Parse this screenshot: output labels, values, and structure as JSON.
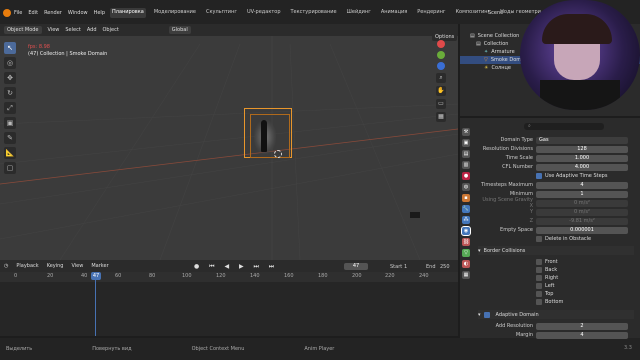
{
  "menu": {
    "items": [
      "File",
      "Edit",
      "Render",
      "Window",
      "Help"
    ]
  },
  "workspaces": {
    "tabs": [
      "Планировка",
      "Моделирование",
      "Скульптинг",
      "UV-редактор",
      "Текстурирование",
      "Шейдинг",
      "Анимация",
      "Рендеринг",
      "Композитинг",
      "Ноды геометри"
    ],
    "active": "Планировка"
  },
  "scene": {
    "label": "Scene"
  },
  "viewport": {
    "mode": "Object Mode",
    "view": "View",
    "select": "Select",
    "add": "Add",
    "object": "Object",
    "transform": "Global",
    "options": "Options",
    "fps": "fps: 8.98",
    "collection": "(47) Collection | Smoke Domain"
  },
  "timeline": {
    "playback": "Playback",
    "keying": "Keying",
    "view": "View",
    "marker": "Marker",
    "current_frame": "47",
    "start_label": "Start",
    "start": "1",
    "end_label": "End",
    "end": "250",
    "ticks": [
      "0",
      "20",
      "40",
      "60",
      "80",
      "100",
      "120",
      "140",
      "160",
      "180",
      "200",
      "220",
      "240"
    ]
  },
  "status": {
    "select": "Выделить",
    "rotate": "Повернуть вид",
    "context": "Object Context Menu",
    "anim": "Anim Player",
    "version": "3.3"
  },
  "outliner": {
    "root": "Scene Collection",
    "items": [
      {
        "label": "Collection",
        "indent": 1
      },
      {
        "label": "Armature",
        "indent": 2
      },
      {
        "label": "Smoke Dom",
        "indent": 2,
        "selected": true
      },
      {
        "label": "Солнце",
        "indent": 2
      }
    ]
  },
  "properties": {
    "rows": [
      {
        "label": "Domain Type",
        "value": "Gas",
        "dim": false
      },
      {
        "label": "Resolution Divisions",
        "value": "128",
        "dim": false
      },
      {
        "label": "Time Scale",
        "value": "1.000",
        "dim": false
      },
      {
        "label": "CFL Number",
        "value": "4.000",
        "dim": false
      },
      {
        "label": "Timesteps Maximum",
        "value": "4",
        "dim": false
      },
      {
        "label": "Minimum",
        "value": "1",
        "dim": false
      },
      {
        "label": "Using Scene Gravity X",
        "value": "0 m/s²",
        "dim": true
      },
      {
        "label": "Y",
        "value": "0 m/s²",
        "dim": true
      },
      {
        "label": "Z",
        "value": "-9.81 m/s²",
        "dim": true
      },
      {
        "label": "Empty Space",
        "value": "0.000001",
        "dim": false
      }
    ],
    "adaptive_time": "Use Adaptive Time Steps",
    "delete_obstacle": "Delete in Obstacle",
    "border_title": "Border Collisions",
    "borders": [
      "Front",
      "Back",
      "Right",
      "Left",
      "Top",
      "Bottom"
    ],
    "adaptive_domain": "Adaptive Domain",
    "add_resolution_label": "Add Resolution",
    "add_resolution": "2",
    "margin_label": "Margin",
    "margin": "4"
  },
  "colors": {
    "accent": "#4772b3",
    "selection": "#e8962c"
  }
}
